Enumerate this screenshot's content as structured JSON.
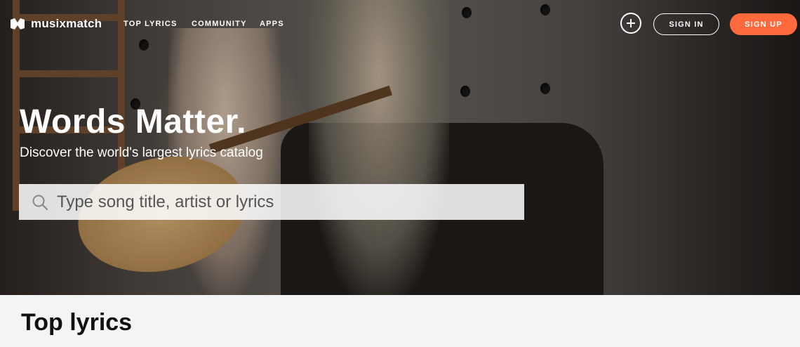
{
  "brand": {
    "name": "musixmatch",
    "accent": "#ff6a3d"
  },
  "nav": {
    "links": [
      "TOP LYRICS",
      "COMMUNITY",
      "APPS"
    ],
    "add_icon": "plus-icon",
    "sign_in": "SIGN IN",
    "sign_up": "SIGN UP"
  },
  "hero": {
    "headline": "Words Matter.",
    "subheadline": "Discover the world's largest lyrics catalog",
    "search": {
      "placeholder": "Type song title, artist or lyrics",
      "icon": "search-icon"
    }
  },
  "section": {
    "title": "Top lyrics"
  }
}
